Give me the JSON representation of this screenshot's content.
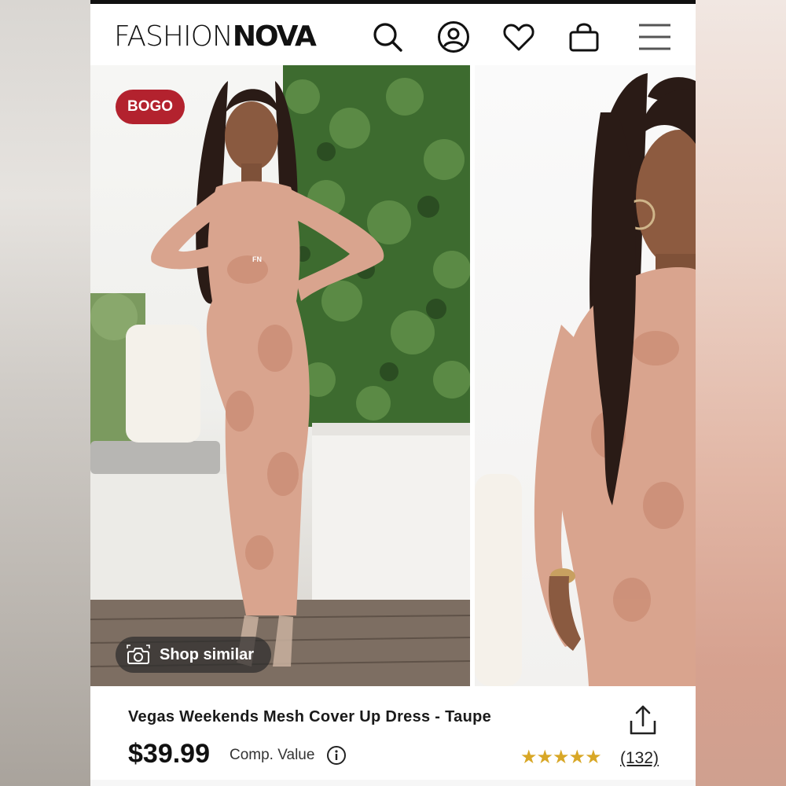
{
  "brand": {
    "logo_light": "FASHION",
    "logo_bold": "NOVA"
  },
  "header": {
    "icons": [
      "search-icon",
      "account-icon",
      "wishlist-heart-icon",
      "shopping-bag-icon",
      "menu-icon"
    ]
  },
  "gallery": {
    "badge": "BOGO",
    "shop_similar_label": "Shop similar",
    "logo_on_dress": "FN"
  },
  "product": {
    "title": "Vegas Weekends Mesh Cover Up Dress - Taupe",
    "price": "$39.99",
    "comp_value_label": "Comp. Value",
    "rating_stars": "★★★★★",
    "rating": 5,
    "review_count": "(132)"
  },
  "colors": {
    "badge": "#b3222e",
    "star": "#d8a726",
    "text": "#111111"
  }
}
